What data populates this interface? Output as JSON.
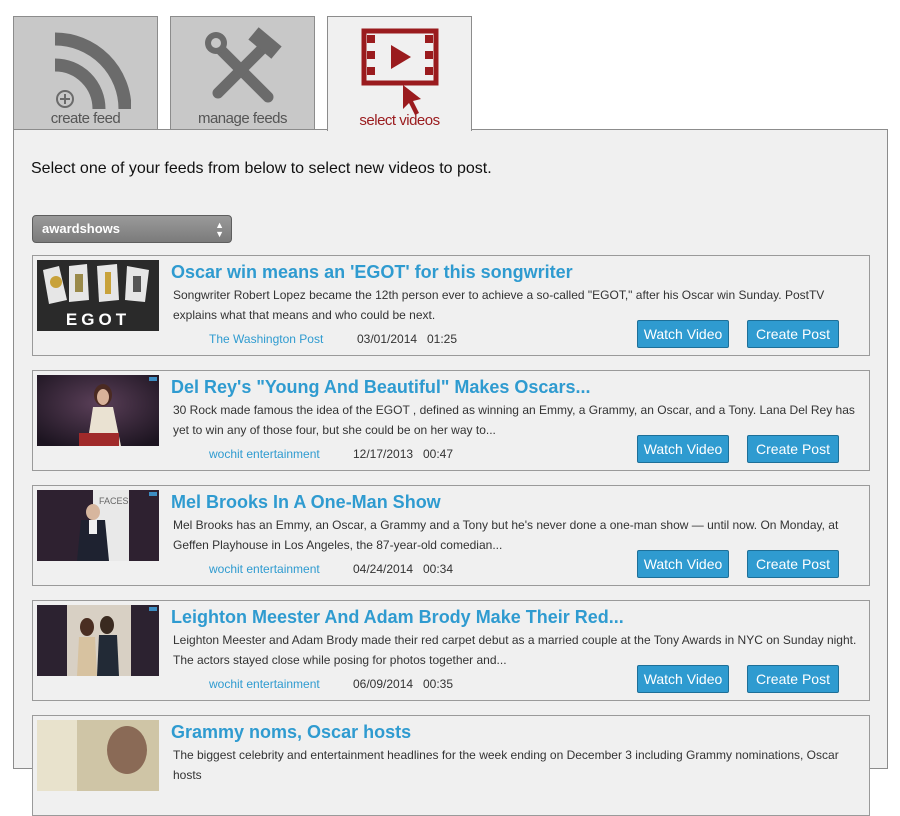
{
  "tabs": [
    {
      "label": "create feed",
      "icon": "rss-plus-icon"
    },
    {
      "label": "manage feeds",
      "icon": "tools-icon"
    },
    {
      "label": "select videos",
      "icon": "video-select-icon"
    }
  ],
  "colors": {
    "accent": "#2f9bd0",
    "active_tab": "#9a1b1e"
  },
  "intro": "Select one of your feeds from below to select new videos to post.",
  "feed_select": {
    "value": "awardshows"
  },
  "buttons": {
    "watch": "Watch Video",
    "create": "Create Post"
  },
  "videos": [
    {
      "title": "Oscar win means an 'EGOT' for this songwriter",
      "desc": "Songwriter Robert Lopez became the 12th person ever to achieve a so-called \"EGOT,\" after his Oscar win Sunday. PostTV explains what that means and who could be next.",
      "source": "The Washington Post",
      "date": "03/01/2014",
      "duration": "01:25",
      "thumb_text": "EGOT"
    },
    {
      "title": "Del Rey's \"Young And Beautiful\" Makes Oscars...",
      "desc": "30 Rock made famous the idea of the EGOT , defined as winning an Emmy, a Grammy, an Oscar, and a Tony. Lana Del Rey has yet to win any of those four, but she could be on her way to...",
      "source": "wochit entertainment",
      "date": "12/17/2013",
      "duration": "00:47"
    },
    {
      "title": "Mel Brooks In A One-Man Show",
      "desc": "Mel Brooks has an Emmy, an Oscar, a Grammy and a Tony but he's never done a one-man show — until now. On Monday, at Geffen Playhouse in Los Angeles, the 87-year-old comedian...",
      "source": "wochit entertainment",
      "date": "04/24/2014",
      "duration": "00:34"
    },
    {
      "title": "Leighton Meester And Adam Brody Make Their Red...",
      "desc": "Leighton Meester and Adam Brody made their red carpet debut as a married couple at the Tony Awards in NYC on Sunday night. The actors stayed close while posing for photos together and...",
      "source": "wochit entertainment",
      "date": "06/09/2014",
      "duration": "00:35"
    },
    {
      "title": "Grammy noms, Oscar hosts",
      "desc": "The biggest celebrity and entertainment headlines for the week ending on December 3 including Grammy nominations, Oscar hosts",
      "source": "",
      "date": "",
      "duration": ""
    }
  ]
}
